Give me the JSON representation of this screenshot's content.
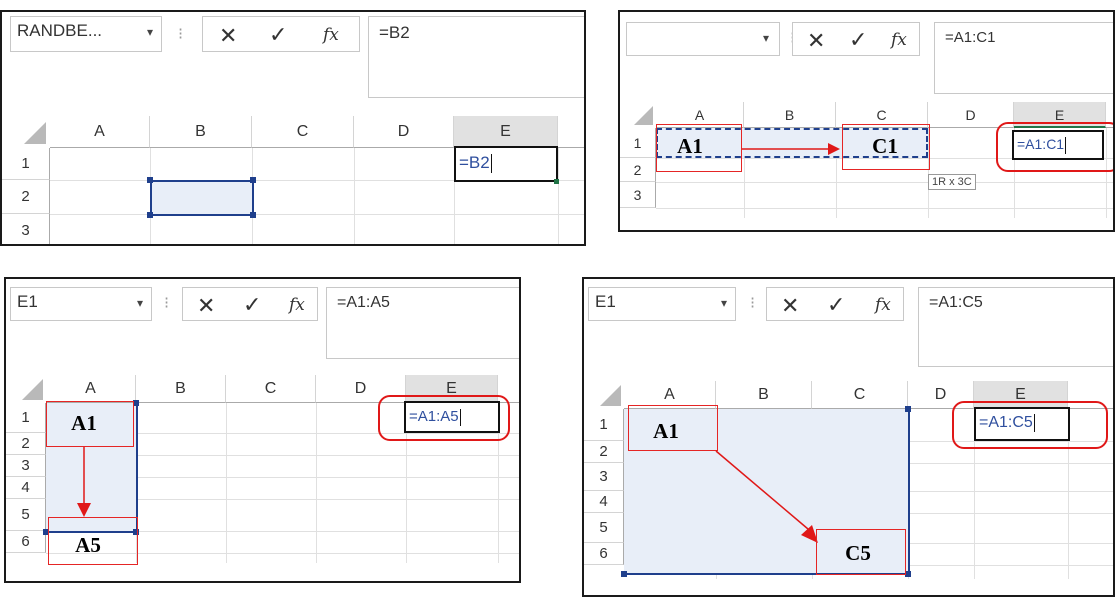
{
  "panel1": {
    "namebox": "RANDBE...",
    "formula": "=B2",
    "columns": [
      "A",
      "B",
      "C",
      "D",
      "E"
    ],
    "rows": [
      "1",
      "2",
      "3"
    ],
    "cell_edit": "=B2"
  },
  "panel2": {
    "namebox": "",
    "formula": "=A1:C1",
    "columns": [
      "A",
      "B",
      "C",
      "D",
      "E"
    ],
    "rows": [
      "1",
      "2",
      "3"
    ],
    "cell_edit": "=A1:C1",
    "label_start": "A1",
    "label_end": "C1",
    "tooltip": "1R x 3C"
  },
  "panel3": {
    "namebox": "E1",
    "formula": "=A1:A5",
    "columns": [
      "A",
      "B",
      "C",
      "D",
      "E"
    ],
    "rows": [
      "1",
      "2",
      "3",
      "4",
      "5",
      "6"
    ],
    "cell_edit": "=A1:A5",
    "label_start": "A1",
    "label_end": "A5"
  },
  "panel4": {
    "namebox": "E1",
    "formula": "=A1:C5",
    "columns": [
      "A",
      "B",
      "C",
      "D",
      "E"
    ],
    "rows": [
      "1",
      "2",
      "3",
      "4",
      "5",
      "6"
    ],
    "cell_edit": "=A1:C5",
    "label_start": "A1",
    "label_end": "C5"
  },
  "icons": {
    "dropdown": "▾",
    "separator": "⁝",
    "cancel": "✕",
    "confirm": "✓",
    "function": "fx"
  }
}
